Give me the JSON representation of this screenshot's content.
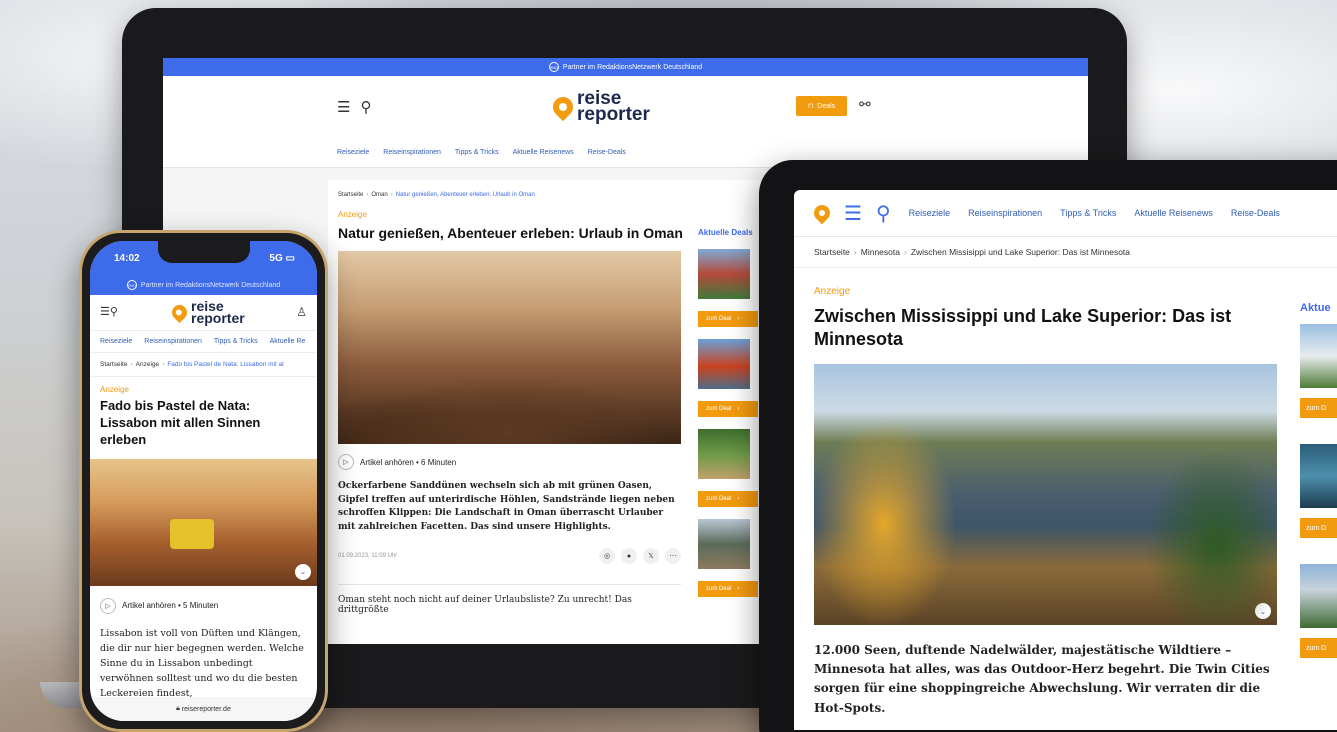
{
  "colors": {
    "brand_blue": "#3d6be9",
    "brand_orange": "#f39b0f",
    "logo_navy": "#1d2a4d"
  },
  "laptop": {
    "partner_banner": "Partner im RedaktionsNetzwerk Deutschland",
    "logo": {
      "top": "reise",
      "bottom": "reporter"
    },
    "deals_label": "Deals",
    "nav": [
      "Reiseziele",
      "Reiseinspirationen",
      "Tipps & Tricks",
      "Aktuelle Reisenews",
      "Reise-Deals"
    ],
    "breadcrumb": [
      "Startseite",
      "Oman",
      "Natur genießen, Abenteuer erleben: Urlaub in Oman"
    ],
    "anzeige": "Anzeige",
    "title": "Natur genießen, Abenteuer erleben: Urlaub in Oman",
    "listen": "Artikel anhören • 6 Minuten",
    "teaser": "Ockerfarbene Sanddünen wechseln sich ab mit grünen Oasen, Gipfel treffen auf unterirdische Höhlen, Sandstrände liegen neben schroffen Klippen: Die Landschaft in Oman überrascht Urlauber mit zahlreichen Facetten. Das sind unsere Highlights.",
    "date": "01.09.2023, 11:09 Uhr",
    "body": "Oman steht noch nicht auf deiner Urlaubsliste? Zu unrecht! Das drittgrößte",
    "sidebar_title": "Aktuelle Deals",
    "deal_button": "zum Deal"
  },
  "tablet": {
    "nav": [
      "Reiseziele",
      "Reiseinspirationen",
      "Tipps & Tricks",
      "Aktuelle Reisenews",
      "Reise-Deals"
    ],
    "breadcrumb": [
      "Startseite",
      "Minnesota",
      "Zwischen Missisippi und Lake Superior: Das ist Minnesota"
    ],
    "anzeige": "Anzeige",
    "title": "Zwischen Mississippi und Lake Superior: Das ist Minnesota",
    "teaser": "12.000 Seen, duftende Nadelwälder, majestätische Wildtiere – Minnesota hat alles, was das Outdoor-Herz begehrt. Die Twin Cities sorgen für eine shoppingreiche Abwechslung. Wir verraten dir die Hot-Spots.",
    "sidebar_title": "Aktue",
    "deal_button": "zum D"
  },
  "phone": {
    "time": "14:02",
    "network": "5G",
    "partner_banner": "Partner im RedaktionsNetzwerk Deutschland",
    "logo": {
      "top": "reise",
      "bottom": "reporter"
    },
    "nav": [
      "Reiseziele",
      "Reiseinspirationen",
      "Tipps & Tricks",
      "Aktuelle Re"
    ],
    "breadcrumb": [
      "Startseite",
      "Anzeige",
      "Fado bis Pastel de Nata: Lissabon mit al"
    ],
    "anzeige": "Anzeige",
    "title": "Fado bis Pastel de Nata: Lissabon mit allen Sinnen erleben",
    "listen": "Artikel anhören • 5 Minuten",
    "teaser": "Lissabon ist voll von Düften und Klängen, die dir nur hier begegnen werden. Welche Sinne du in Lissabon unbedingt verwöhnen solltest und wo du die besten Leckereien findest,",
    "url": "reisereporter.de"
  }
}
